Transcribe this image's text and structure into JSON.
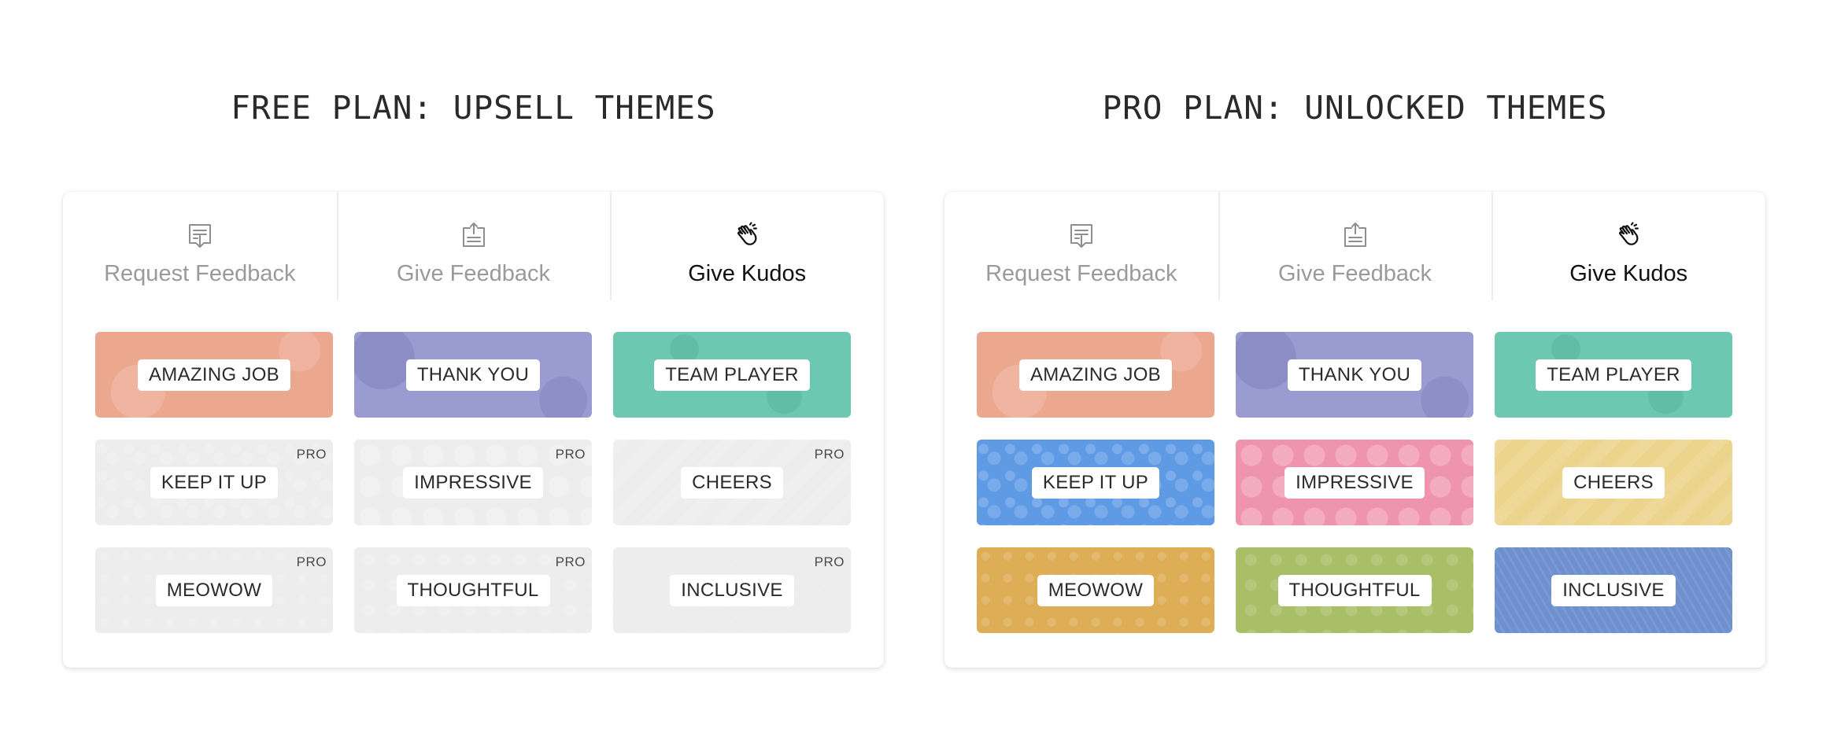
{
  "sections": [
    {
      "title": "FREE PLAN: UPSELL THEMES",
      "tabs": [
        {
          "label": "Request Feedback",
          "icon": "request-feedback-icon"
        },
        {
          "label": "Give Feedback",
          "icon": "give-feedback-icon"
        },
        {
          "label": "Give Kudos",
          "icon": "clapping-hand-icon"
        }
      ],
      "themes": [
        {
          "label": "AMAZING JOB",
          "color": "#eca78f"
        },
        {
          "label": "THANK YOU",
          "color": "#9a9bd0"
        },
        {
          "label": "TEAM PLAYER",
          "color": "#6cc8b1"
        },
        {
          "label": "KEEP IT UP",
          "color": "#ededed",
          "badge": "PRO"
        },
        {
          "label": "IMPRESSIVE",
          "color": "#ededed",
          "badge": "PRO"
        },
        {
          "label": "CHEERS",
          "color": "#ededed",
          "badge": "PRO"
        },
        {
          "label": "MEOWOW",
          "color": "#ededed",
          "badge": "PRO"
        },
        {
          "label": "THOUGHTFUL",
          "color": "#ededed",
          "badge": "PRO"
        },
        {
          "label": "INCLUSIVE",
          "color": "#ededed",
          "badge": "PRO"
        }
      ]
    },
    {
      "title": "PRO PLAN: UNLOCKED THEMES",
      "tabs": [
        {
          "label": "Request Feedback",
          "icon": "request-feedback-icon"
        },
        {
          "label": "Give Feedback",
          "icon": "give-feedback-icon"
        },
        {
          "label": "Give Kudos",
          "icon": "clapping-hand-icon"
        }
      ],
      "themes": [
        {
          "label": "AMAZING JOB",
          "color": "#eca78f"
        },
        {
          "label": "THANK YOU",
          "color": "#9a9bd0"
        },
        {
          "label": "TEAM PLAYER",
          "color": "#6cc8b1"
        },
        {
          "label": "KEEP IT UP",
          "color": "#5f9ae5"
        },
        {
          "label": "IMPRESSIVE",
          "color": "#ef94ae"
        },
        {
          "label": "CHEERS",
          "color": "#ecd48c"
        },
        {
          "label": "MEOWOW",
          "color": "#deae57"
        },
        {
          "label": "THOUGHTFUL",
          "color": "#a8bf68"
        },
        {
          "label": "INCLUSIVE",
          "color": "#6f90cf"
        }
      ]
    }
  ],
  "active_tab_label": "Give Kudos"
}
